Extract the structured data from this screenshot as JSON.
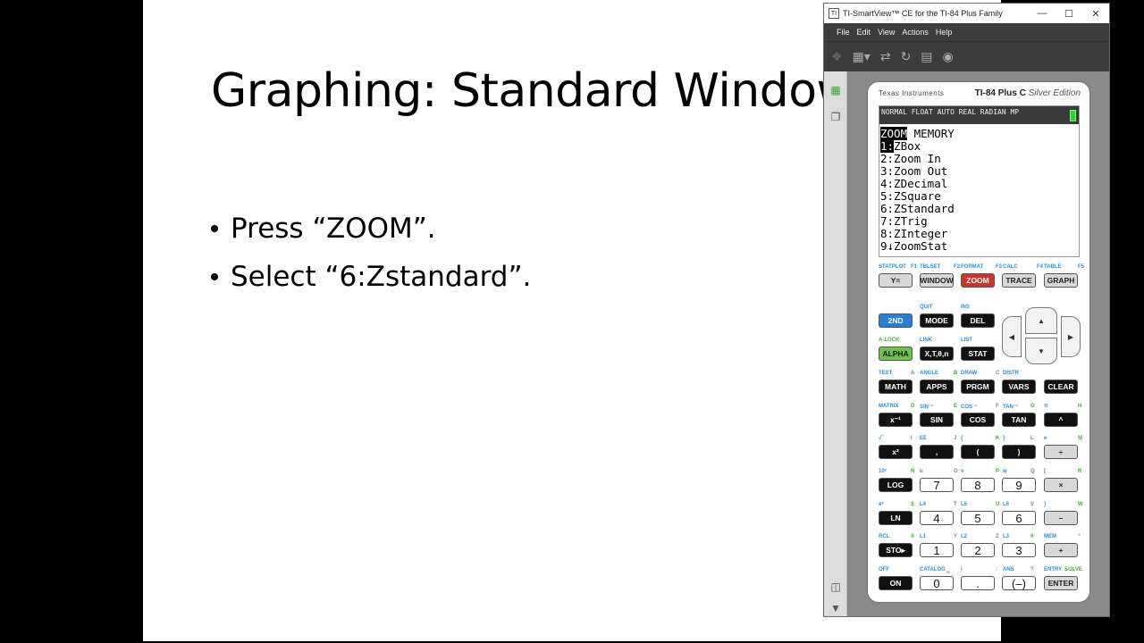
{
  "slide": {
    "title": "Graphing: Standard Window",
    "bullets": [
      "Press “ZOOM”.",
      "Select “6:Zstandard”."
    ]
  },
  "window": {
    "title": "TI-SmartView™ CE for the TI-84 Plus Family",
    "menu": [
      "File",
      "Edit",
      "View",
      "Actions",
      "Help"
    ]
  },
  "calculator": {
    "brand": "Texas Instruments",
    "model": "TI-84 Plus C",
    "edition": "Silver Edition",
    "status": "NORMAL FLOAT AUTO REAL RADIAN MP",
    "tabs": [
      "ZOOM",
      "MEMORY"
    ],
    "menu_items": [
      "1:ZBox",
      "2:Zoom In",
      "3:Zoom Out",
      "4:ZDecimal",
      "5:ZSquare",
      "6:ZStandard",
      "7:ZTrig",
      "8:ZInteger",
      "9↓ZoomStat"
    ],
    "key_rows": [
      {
        "labels": [
          [
            "STATPLOT",
            "b",
            2
          ],
          [
            "F1",
            "b",
            38
          ],
          [
            "TBLSET",
            "b",
            48
          ],
          [
            "F2",
            "b",
            86
          ],
          [
            "FORMAT",
            "b",
            94
          ],
          [
            "F3",
            "b",
            133
          ],
          [
            "CALC",
            "b",
            141
          ],
          [
            "F4",
            "b",
            179
          ],
          [
            "TABLE",
            "b",
            187
          ],
          [
            "F5",
            "b",
            225
          ]
        ],
        "keys": [
          [
            "Y=",
            "grey"
          ],
          [
            "WINDOW",
            "grey"
          ],
          [
            "ZOOM",
            "red"
          ],
          [
            "TRACE",
            "grey"
          ],
          [
            "GRAPH",
            "grey"
          ]
        ]
      },
      {
        "labels": [
          [
            "QUIT",
            "b",
            48
          ],
          [
            "INS",
            "b",
            94
          ]
        ],
        "keys": [
          [
            "2ND",
            "blue"
          ],
          [
            "MODE",
            "black"
          ],
          [
            "DEL",
            "black"
          ]
        ]
      },
      {
        "labels": [
          [
            "A-LOCK",
            "g",
            2
          ],
          [
            "LINK",
            "b",
            48
          ],
          [
            "LIST",
            "b",
            94
          ]
        ],
        "keys": [
          [
            "ALPHA",
            "green"
          ],
          [
            "X,T,θ,n",
            "black"
          ],
          [
            "STAT",
            "black"
          ]
        ]
      },
      {
        "labels": [
          [
            "TEST",
            "b",
            2
          ],
          [
            "A",
            "g",
            38
          ],
          [
            "ANGLE",
            "b",
            48
          ],
          [
            "B",
            "g",
            86
          ],
          [
            "DRAW",
            "b",
            94
          ],
          [
            "C",
            "g",
            133
          ],
          [
            "DISTR",
            "b",
            141
          ]
        ],
        "keys": [
          [
            "MATH",
            "black"
          ],
          [
            "APPS",
            "black"
          ],
          [
            "PRGM",
            "black"
          ],
          [
            "VARS",
            "black"
          ],
          [
            "CLEAR",
            "black"
          ]
        ]
      },
      {
        "labels": [
          [
            "MATRIX",
            "b",
            2
          ],
          [
            "D",
            "g",
            38
          ],
          [
            "SIN⁻¹",
            "b",
            48
          ],
          [
            "E",
            "g",
            86
          ],
          [
            "COS⁻¹",
            "b",
            94
          ],
          [
            "F",
            "g",
            133
          ],
          [
            "TAN⁻¹",
            "b",
            141
          ],
          [
            "G",
            "g",
            172
          ],
          [
            "π",
            "b",
            187
          ],
          [
            "H",
            "g",
            225
          ]
        ],
        "keys": [
          [
            "x⁻¹",
            "black"
          ],
          [
            "SIN",
            "black"
          ],
          [
            "COS",
            "black"
          ],
          [
            "TAN",
            "black"
          ],
          [
            "^",
            "black"
          ]
        ]
      },
      {
        "labels": [
          [
            "√‾",
            "b",
            2
          ],
          [
            "I",
            "g",
            38
          ],
          [
            "EE",
            "b",
            48
          ],
          [
            "J",
            "g",
            86
          ],
          [
            "{",
            "b",
            94
          ],
          [
            "K",
            "g",
            133
          ],
          [
            "}",
            "b",
            141
          ],
          [
            "L",
            "g",
            172
          ],
          [
            "e",
            "b",
            187
          ],
          [
            "M",
            "g",
            225
          ]
        ],
        "keys": [
          [
            "x²",
            "black"
          ],
          [
            ",",
            "black"
          ],
          [
            "(",
            "black"
          ],
          [
            ")",
            "black"
          ],
          [
            "÷",
            "grey"
          ]
        ]
      },
      {
        "labels": [
          [
            "10ˣ",
            "b",
            2
          ],
          [
            "N",
            "g",
            38
          ],
          [
            "u",
            "b",
            48
          ],
          [
            "O",
            "g",
            86
          ],
          [
            "v",
            "b",
            94
          ],
          [
            "P",
            "g",
            133
          ],
          [
            "w",
            "b",
            141
          ],
          [
            "Q",
            "g",
            172
          ],
          [
            "[",
            "b",
            187
          ],
          [
            "R",
            "g",
            225
          ]
        ],
        "keys": [
          [
            "LOG",
            "black"
          ],
          [
            "7",
            "white"
          ],
          [
            "8",
            "white"
          ],
          [
            "9",
            "white"
          ],
          [
            "×",
            "grey"
          ]
        ]
      },
      {
        "labels": [
          [
            "eˣ",
            "b",
            2
          ],
          [
            "S",
            "g",
            38
          ],
          [
            "L4",
            "b",
            48
          ],
          [
            "T",
            "g",
            86
          ],
          [
            "L5",
            "b",
            94
          ],
          [
            "U",
            "g",
            133
          ],
          [
            "L6",
            "b",
            141
          ],
          [
            "V",
            "g",
            172
          ],
          [
            "]",
            "b",
            187
          ],
          [
            "W",
            "g",
            225
          ]
        ],
        "keys": [
          [
            "LN",
            "black"
          ],
          [
            "4",
            "white"
          ],
          [
            "5",
            "white"
          ],
          [
            "6",
            "white"
          ],
          [
            "–",
            "grey"
          ]
        ]
      },
      {
        "labels": [
          [
            "RCL",
            "b",
            2
          ],
          [
            "X",
            "g",
            38
          ],
          [
            "L1",
            "b",
            48
          ],
          [
            "Y",
            "g",
            86
          ],
          [
            "L2",
            "b",
            94
          ],
          [
            "Z",
            "g",
            133
          ],
          [
            "L3",
            "b",
            141
          ],
          [
            "θ",
            "g",
            172
          ],
          [
            "MEM",
            "b",
            187
          ],
          [
            "“",
            "g",
            225
          ]
        ],
        "keys": [
          [
            "STO▸",
            "black"
          ],
          [
            "1",
            "white"
          ],
          [
            "2",
            "white"
          ],
          [
            "3",
            "white"
          ],
          [
            "+",
            "grey"
          ]
        ]
      },
      {
        "labels": [
          [
            "OFF",
            "b",
            2
          ],
          [
            "CATALOG",
            "b",
            48
          ],
          [
            "␣",
            "g",
            78
          ],
          [
            "i",
            "b",
            94
          ],
          [
            ":",
            "g",
            133
          ],
          [
            "ANS",
            "b",
            141
          ],
          [
            "?",
            "g",
            172
          ],
          [
            "ENTRY",
            "b",
            187
          ],
          [
            "SOLVE",
            "g",
            210
          ]
        ],
        "keys": [
          [
            "ON",
            "black"
          ],
          [
            "0",
            "white"
          ],
          [
            ".",
            "white"
          ],
          [
            "(–)",
            "white"
          ],
          [
            "ENTER",
            "grey"
          ]
        ]
      }
    ]
  }
}
